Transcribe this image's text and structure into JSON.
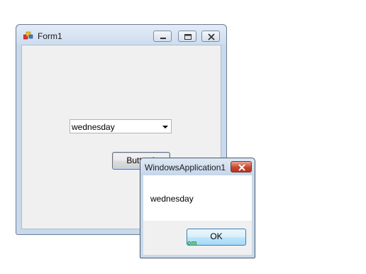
{
  "form1": {
    "title": "Form1",
    "combo_value": "wednesday",
    "button1_label": "Button1"
  },
  "messagebox": {
    "title": "WindowsApplication1",
    "message": "wednesday",
    "ok_label": "OK",
    "watermark_fragment": "om"
  },
  "colors": {
    "title_gradient_top": "#e3ecf7",
    "close_button_red": "#c9462d",
    "watermark_green": "#1f9d3a"
  }
}
